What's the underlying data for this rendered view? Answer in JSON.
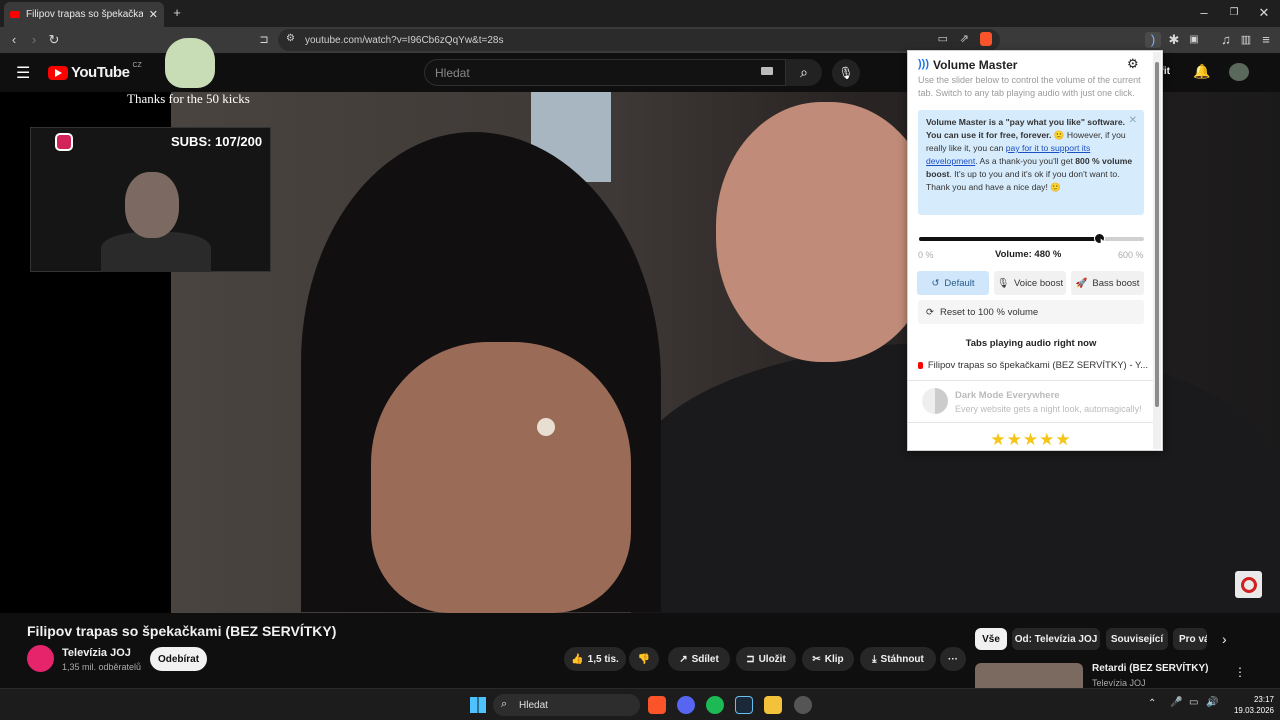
{
  "browser": {
    "tab_title": "Filipov trapas so špekačkami |",
    "new_tab": "+",
    "url": "youtube.com/watch?v=I96Cb6zQqYw&t=28s"
  },
  "youtube": {
    "logo_text": "YouTube",
    "logo_region": "CZ",
    "search_placeholder": "Hledat",
    "signin_fragment": "řit"
  },
  "overlay": {
    "kicks_text": "Thanks for the 50 kicks",
    "subs_text": "SUBS: 107/200"
  },
  "video": {
    "title": "Filipov trapas so špekačkami (BEZ SERVÍTKY)",
    "channel_name": "Televízia JOJ",
    "channel_subs": "1,35 mil. odběratelů",
    "subscribe_label": "Odebírat",
    "likes": "1,5 tis.",
    "share_label": "Sdílet",
    "save_label": "Uložit",
    "clip_label": "Klip",
    "download_label": "Stáhnout",
    "more_label": "···"
  },
  "chips": [
    "Vše",
    "Od: Televízia JOJ",
    "Související",
    "Pro vá"
  ],
  "recommended": {
    "title": "Retardi (BEZ SERVÍTKY)",
    "channel": "Televízia JOJ"
  },
  "taskbar": {
    "search_label": "Hledat",
    "time": "23:17",
    "date": "19.03.2026"
  },
  "volume_master": {
    "title": "Volume Master",
    "description": "Use the slider below to control the volume of the current tab. Switch to any tab playing audio with just one click.",
    "note_part1": "Volume Master is a \"pay what you like\" software. You can use it for free, forever.",
    "note_part2": " However, if you really like it, you can ",
    "note_link": "pay for it to support its development",
    "note_part3": ". As a thank-you you'll get ",
    "note_bold": "800 % volume boost",
    "note_part4": ". It's up to you and it's ok if you don't want to. Thank you and have a nice day!",
    "slider_min_label": "0 %",
    "slider_max_label": "600 %",
    "volume_label": "Volume: 480 %",
    "volume_fraction": 0.8,
    "default_label": "Default",
    "voice_boost_label": "Voice boost",
    "bass_boost_label": "Bass boost",
    "reset_label": "Reset to 100 % volume",
    "tabs_heading": "Tabs playing audio right now",
    "tab_playing": "Filipov trapas so špekačkami (BEZ SERVÍTKY) - Y...",
    "promo_title": "Dark Mode Everywhere",
    "promo_subtitle": "Every website gets a night look, automagically!",
    "stars": "★★★★★"
  },
  "colors": {
    "youtube_red": "#ff0000",
    "vm_accent": "#1a73e8",
    "note_bg": "#d6ebfb",
    "star": "#f5c518"
  }
}
